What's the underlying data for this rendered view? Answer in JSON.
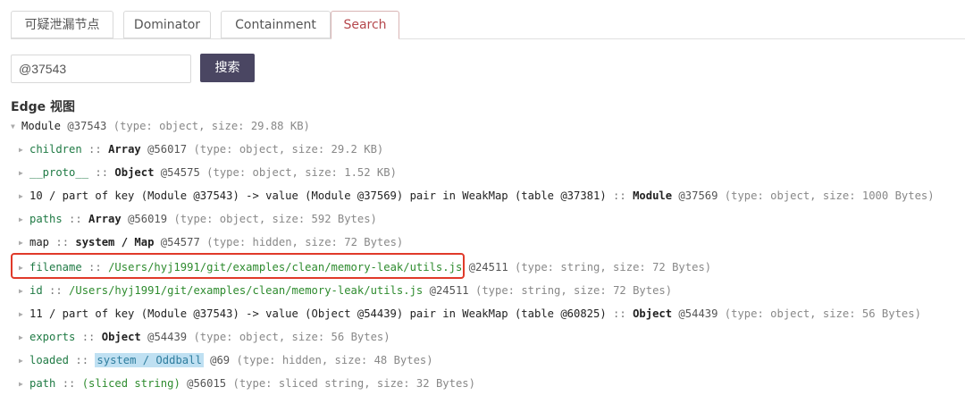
{
  "tabs": [
    {
      "label": "可疑泄漏节点"
    },
    {
      "label": "Dominator"
    },
    {
      "label": "Containment"
    },
    {
      "label": "Search",
      "active": true
    }
  ],
  "search": {
    "value": "@37543",
    "button_label": "搜索"
  },
  "edge_view_title": "Edge 视图",
  "tree": {
    "root": {
      "name": "Module",
      "addr": "@37543",
      "meta": "(type: object, size: 29.88 KB)"
    },
    "rows": [
      {
        "key": "children",
        "sep": " :: ",
        "cls": "Array",
        "addr": " @56017 ",
        "meta": "(type: object, size: 29.2 KB)"
      },
      {
        "key": "__proto__",
        "sep": " :: ",
        "cls": "Object",
        "addr": " @54575 ",
        "meta": "(type: object, size: 1.52 KB)"
      },
      {
        "lbl": "10 / part of key (Module @37543) -> value (Module @37569) pair in WeakMap (table @37381)",
        "sep": " :: ",
        "cls": "Module",
        "addr": " @37569 ",
        "meta": "(type: object, size: 1000 Bytes)"
      },
      {
        "key": "paths",
        "sep": " :: ",
        "cls": "Array",
        "addr": " @56019 ",
        "meta": "(type: object, size: 592 Bytes)"
      },
      {
        "lbl": "map",
        "sep": " :: ",
        "cls": "system / Map",
        "addr": " @54577 ",
        "meta": "(type: hidden, size: 72 Bytes)"
      },
      {
        "key": "filename",
        "sep": " :: ",
        "str": "/Users/hyj1991/git/examples/clean/memory-leak/utils.js",
        "addr": " @24511 ",
        "meta": "(type: string, size: 72 Bytes)"
      },
      {
        "key": "id",
        "sep": " :: ",
        "str": "/Users/hyj1991/git/examples/clean/memory-leak/utils.js",
        "addr": " @24511 ",
        "meta": "(type: string, size: 72 Bytes)"
      },
      {
        "lbl": "11 / part of key (Module @37543) -> value (Object @54439) pair in WeakMap (table @60825)",
        "sep": " :: ",
        "cls": "Object",
        "addr": " @54439 ",
        "meta": "(type: object, size: 56 Bytes)"
      },
      {
        "key": "exports",
        "sep": " :: ",
        "cls": "Object",
        "addr": " @54439 ",
        "meta": "(type: object, size: 56 Bytes)"
      },
      {
        "key": "loaded",
        "sep": " :: ",
        "hl": "system / Oddball",
        "addr": " @69 ",
        "meta": "(type: hidden, size: 48 Bytes)"
      },
      {
        "key": "path",
        "sep": " :: ",
        "str": "(sliced string)",
        "addr": " @56015 ",
        "meta": "(type: sliced string, size: 32 Bytes)"
      }
    ]
  },
  "colors": {
    "accent": "#b5474c",
    "button": "#4a4662",
    "highlight_box": "#e03a2a",
    "string": "#2e8b2e",
    "key": "#1f7a44",
    "oddball_bg": "#bfe0f2"
  }
}
